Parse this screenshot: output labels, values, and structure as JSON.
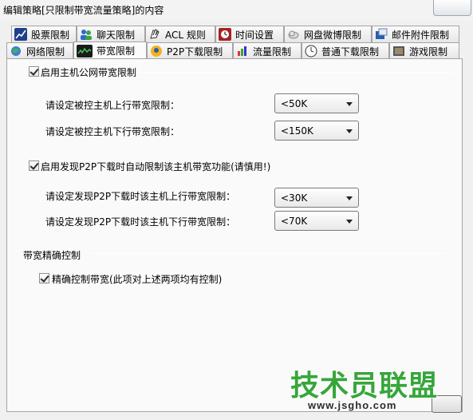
{
  "window": {
    "title": "编辑策略[只限制带宽流量策略]的内容"
  },
  "tabs_row1": [
    {
      "label": "股票限制",
      "icon": "stock-chart-icon"
    },
    {
      "label": "聊天限制",
      "icon": "chat-users-icon"
    },
    {
      "label": "ACL 规则",
      "icon": "acl-hand-icon"
    },
    {
      "label": "时间设置",
      "icon": "clock-icon"
    },
    {
      "label": "网盘微博限制",
      "icon": "cloud-disk-icon"
    },
    {
      "label": "邮件附件限制",
      "icon": "mail-attachment-icon"
    }
  ],
  "tabs_row2": [
    {
      "label": "网络限制",
      "icon": "network-globe-icon"
    },
    {
      "label": "带宽限制",
      "icon": "bandwidth-monitor-icon",
      "active": true
    },
    {
      "label": "P2P下载限制",
      "icon": "p2p-download-icon"
    },
    {
      "label": "流量限制",
      "icon": "traffic-chart-icon"
    },
    {
      "label": "普通下载限制",
      "icon": "download-clock-icon"
    },
    {
      "label": "游戏限制",
      "icon": "game-icon"
    }
  ],
  "host_section": {
    "checkbox_label": "启用主机公网带宽限制",
    "checked": true,
    "upload_label": "请设定被控主机上行带宽限制：",
    "upload_value": "<50K",
    "download_label": "请设定被控主机下行带宽限制：",
    "download_value": "<150K"
  },
  "p2p_section": {
    "checkbox_label": "启用发现P2P下载时自动限制该主机带宽功能(请慎用!)",
    "checked": true,
    "upload_label": "请设定发现P2P下载时该主机上行带宽限制：",
    "upload_value": "<30K",
    "download_label": "请设定发现P2P下载时该主机下行带宽限制：",
    "download_value": "<70K"
  },
  "precision_section": {
    "group_title": "带宽精确控制",
    "checkbox_label": "精确控制带宽(此项对上述两项均有控制)",
    "checked": true
  },
  "watermark": {
    "text": "技术员联盟",
    "url": "www.jsgho.com"
  },
  "colors": {
    "watermark_green": "#36a63a",
    "panel_bg": "#fafafa",
    "window_bg": "#f0f0f0"
  }
}
